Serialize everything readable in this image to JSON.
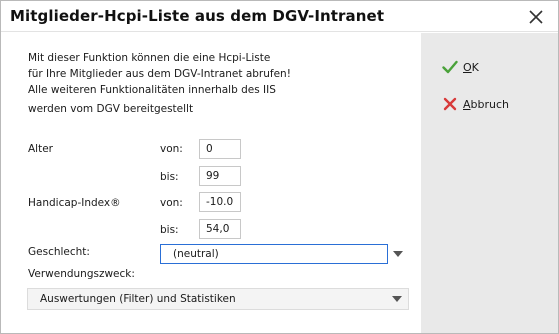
{
  "window": {
    "title": "Mitglieder-Hcpi-Liste aus dem DGV-Intranet"
  },
  "description": [
    "Mit dieser Funktion können die eine Hcpi-Liste",
    "für Ihre Mitglieder aus dem DGV-Intranet abrufen!",
    "Alle weiteren Funktionalitäten innerhalb des IIS",
    "werden vom DGV bereitgestellt"
  ],
  "form": {
    "alter_label": "Alter",
    "von_label": "von:",
    "bis_label": "bis:",
    "alter_von": "0",
    "alter_bis": "99",
    "handicap_label": "Handicap-Index®",
    "hcp_von": "-10.0",
    "hcp_bis": "54,0",
    "geschlecht_label": "Geschlecht:",
    "geschlecht_value": "(neutral)",
    "zweck_label": "Verwendungszweck:",
    "zweck_value": "Auswertungen (Filter) und Statistiken"
  },
  "buttons": {
    "ok_first": "O",
    "ok_rest": "K",
    "abbruch_first": "A",
    "abbruch_rest": "bbruch"
  },
  "colors": {
    "ok_icon": "#4aa23a",
    "cancel_icon": "#d83a3a",
    "focus_border": "#2a6fd6",
    "sidebar_bg": "#e9e9e9"
  }
}
